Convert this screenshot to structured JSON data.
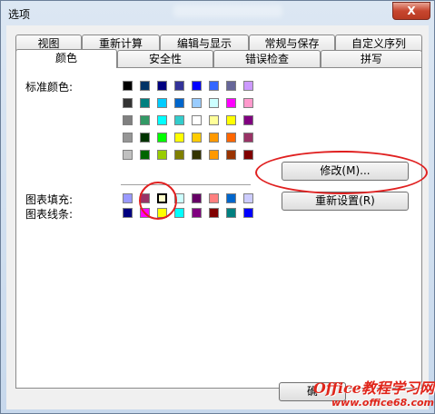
{
  "window": {
    "title": "选项",
    "close_symbol": "X"
  },
  "tabs_row1": [
    "视图",
    "重新计算",
    "编辑与显示",
    "常规与保存",
    "自定义序列"
  ],
  "tabs_row2": [
    "颜色",
    "安全性",
    "错误检查",
    "拼写"
  ],
  "active_tab": "颜色",
  "labels": {
    "standard": "标准颜色:",
    "fill": "图表填充:",
    "line": "图表线条:"
  },
  "colors": {
    "standard": [
      [
        "#000000",
        "#003366",
        "#000080",
        "#333399",
        "#0000ff",
        "#3366ff",
        "#666699",
        "#cc99ff"
      ],
      [
        "#333333",
        "#008080",
        "#00ccff",
        "#0066cc",
        "#99ccff",
        "#ccffff",
        "#ff00ff",
        "#ff99cc"
      ],
      [
        "#808080",
        "#339966",
        "#00ffff",
        "#33cccc",
        "#ffffff",
        "#ffff99",
        "#ffff00",
        "#800080"
      ],
      [
        "#969696",
        "#003300",
        "#00ff00",
        "#ffff00",
        "#ffcc00",
        "#ff9900",
        "#ff6600",
        "#993366"
      ],
      [
        "#c0c0c0",
        "#006600",
        "#99cc00",
        "#808000",
        "#333300",
        "#ff9900",
        "#993300",
        "#800000"
      ]
    ],
    "fill": [
      "#9999ff",
      "#993366",
      "#ffffcc",
      "#ccffff",
      "#660066",
      "#ff8080",
      "#0066cc",
      "#ccccff"
    ],
    "line": [
      "#000080",
      "#ff00ff",
      "#ffff00",
      "#00ffff",
      "#800080",
      "#800000",
      "#008080",
      "#0000ff"
    ]
  },
  "buttons": {
    "modify": "修改(M)...",
    "reset": "重新设置(R)",
    "ok_partial": "确"
  },
  "watermark": {
    "line1": "Office教程学习网",
    "line2": "www.office68.com"
  }
}
